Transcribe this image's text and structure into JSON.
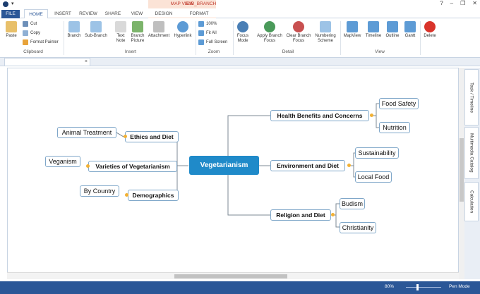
{
  "titlebar": {
    "context_group_map": "MAP VIEW",
    "context_group_sub": "SUB_BRANCH",
    "min_icon": "minimize-icon",
    "restore_icon": "restore-icon",
    "close_icon": "close-icon"
  },
  "tabs": [
    "FILE",
    "HOME",
    "INSERT",
    "REVIEW",
    "SHARE",
    "VIEW",
    "DESIGN",
    "FORMAT"
  ],
  "ribbon": {
    "clipboard": {
      "paste": "Paste",
      "cut": "Cut",
      "copy": "Copy",
      "format_painter": "Format Painter",
      "label": "Clipboard"
    },
    "insert": {
      "branch": "Branch",
      "sub_branch": "Sub-Branch",
      "text_note": "Text",
      "text_note2": "Note",
      "branch_picture": "Branch",
      "branch_picture2": "Picture",
      "attachment": "Attachment",
      "hyperlink": "Hyperlink",
      "label": "Insert"
    },
    "zoom": {
      "z100": "100%",
      "fit_all": "Fit All",
      "full_screen": "Full Screen",
      "label": "Zoom"
    },
    "detail": {
      "focus_mode": "Focus",
      "focus_mode2": "Mode",
      "apply_focus": "Apply Branch",
      "apply_focus2": "Focus",
      "clear_focus": "Clear Branch",
      "clear_focus2": "Focus",
      "numbering": "Numbering",
      "numbering2": "Scheme",
      "label": "Detail"
    },
    "view": {
      "mapview": "MapView",
      "timeline": "Timeline",
      "outline": "Outline",
      "gantt": "Gantt",
      "label": "View"
    },
    "delete": "Delete"
  },
  "doc_tab": {
    "close": "×"
  },
  "side_tabs": [
    "Task / Timeline",
    "Multimedia Catalog",
    "Calculation"
  ],
  "status": {
    "zoom": "80%",
    "pen_mode": "Pen Mode"
  },
  "colors": {
    "accent": "#2b5797",
    "central": "#1f8ac9",
    "connector": "#f2b134",
    "node_border": "#7fa7c9"
  },
  "map": {
    "central": "Vegetarianism",
    "ethics": "Ethics and Diet",
    "animal": "Animal Treatment",
    "varieties": "Varieties of Vegetarianism",
    "veganism": "Veganism",
    "demographics": "Demographics",
    "country": "By Country",
    "health": "Health Benefits and Concerns",
    "food_safety": "Food Safety",
    "nutrition": "Nutrition",
    "environment": "Environment and Diet",
    "sustainability": "Sustainability",
    "local_food": "Local Food",
    "religion": "Religion and Diet",
    "budism": "Budism",
    "christianity": "Christianity"
  }
}
